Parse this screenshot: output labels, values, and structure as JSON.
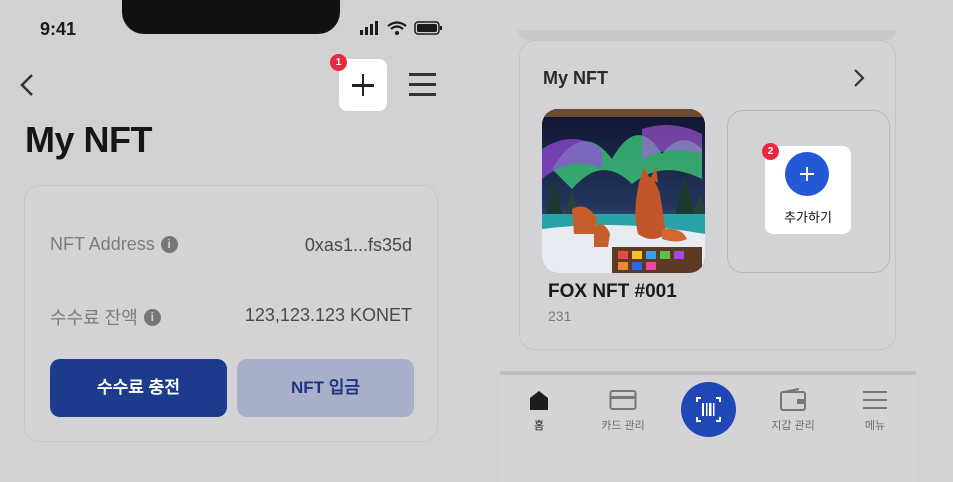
{
  "left": {
    "status_time": "9:41",
    "page_title": "My NFT",
    "badge_1": "1",
    "rows": [
      {
        "label": "NFT Address",
        "value": "0xas1...fs35d"
      },
      {
        "label": "수수료 잔액",
        "value": "123,123.123 KONET"
      }
    ],
    "info_glyph": "i",
    "charge_button": "수수료 충전",
    "deposit_button": "NFT 입금"
  },
  "right": {
    "section_title": "My NFT",
    "nft": {
      "name": "FOX NFT #001",
      "count": "231"
    },
    "add_label": "추가하기",
    "badge_2": "2",
    "tabs": [
      {
        "label": "홈",
        "icon": "home-icon",
        "active": true
      },
      {
        "label": "카드 관리",
        "icon": "card-icon",
        "active": false
      },
      {
        "label": "지갑 관리",
        "icon": "wallet-icon",
        "active": false
      },
      {
        "label": "메뉴",
        "icon": "menu-icon",
        "active": false
      }
    ]
  },
  "colors": {
    "overlay_bg": "#d2d2d4",
    "primary": "#1c3b8d",
    "accent_blue": "#2358d6",
    "badge_red": "#e9283f"
  }
}
